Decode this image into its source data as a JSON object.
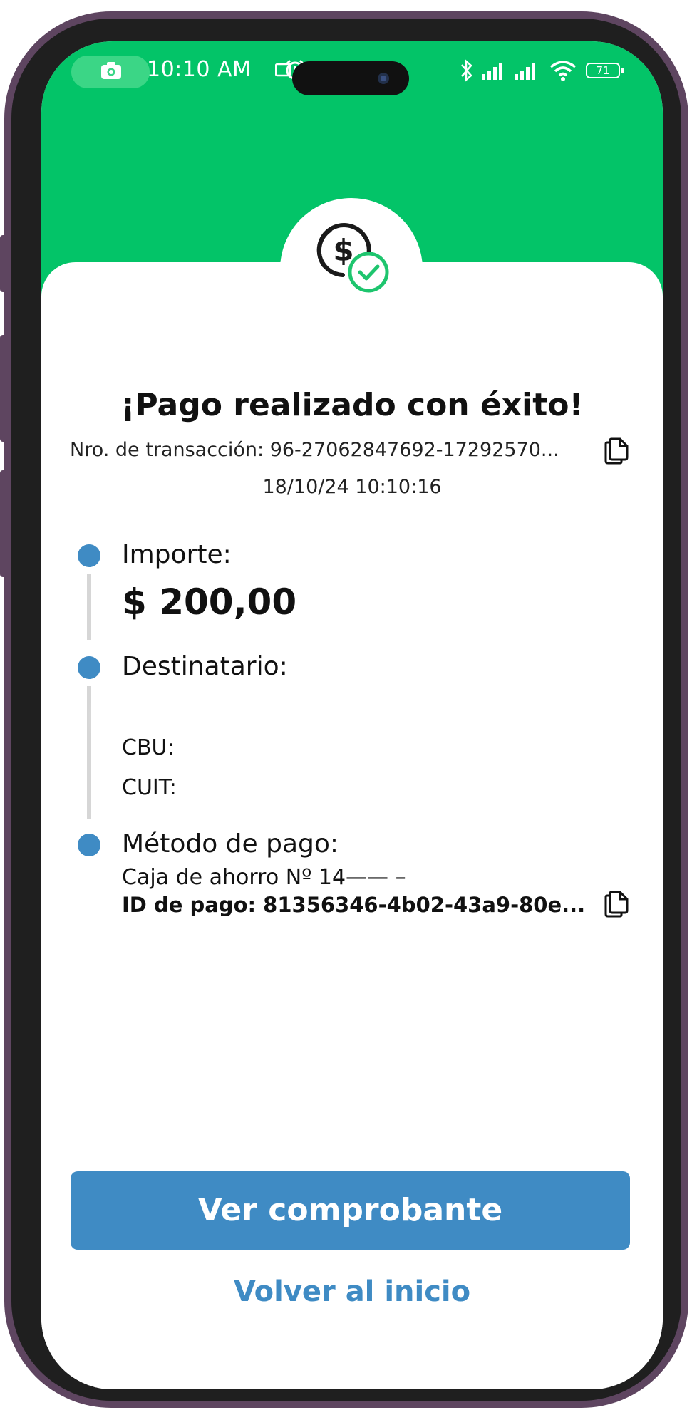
{
  "status_bar": {
    "time": "10:10 AM",
    "battery": "71"
  },
  "receipt": {
    "title": "¡Pago realizado con éxito!",
    "transaction": "Nro. de transacción: 96-27062847692-17292570...",
    "datetime": "18/10/24 10:10:16",
    "amount_label": "Importe:",
    "amount_value": "$ 200,00",
    "recipient_label": "Destinatario:",
    "cbu_label": "CBU:",
    "cuit_label": "CUIT:",
    "method_label": "Método de pago:",
    "account": "Caja de ahorro Nº 14——    –",
    "payment_id": "ID de pago: 81356346-4b02-43a9-80e..."
  },
  "actions": {
    "primary": "Ver comprobante",
    "secondary": "Volver al inicio"
  },
  "colors": {
    "header_green": "#03c468",
    "accent_blue": "#3f8bc4",
    "frame": "#5e4560"
  }
}
